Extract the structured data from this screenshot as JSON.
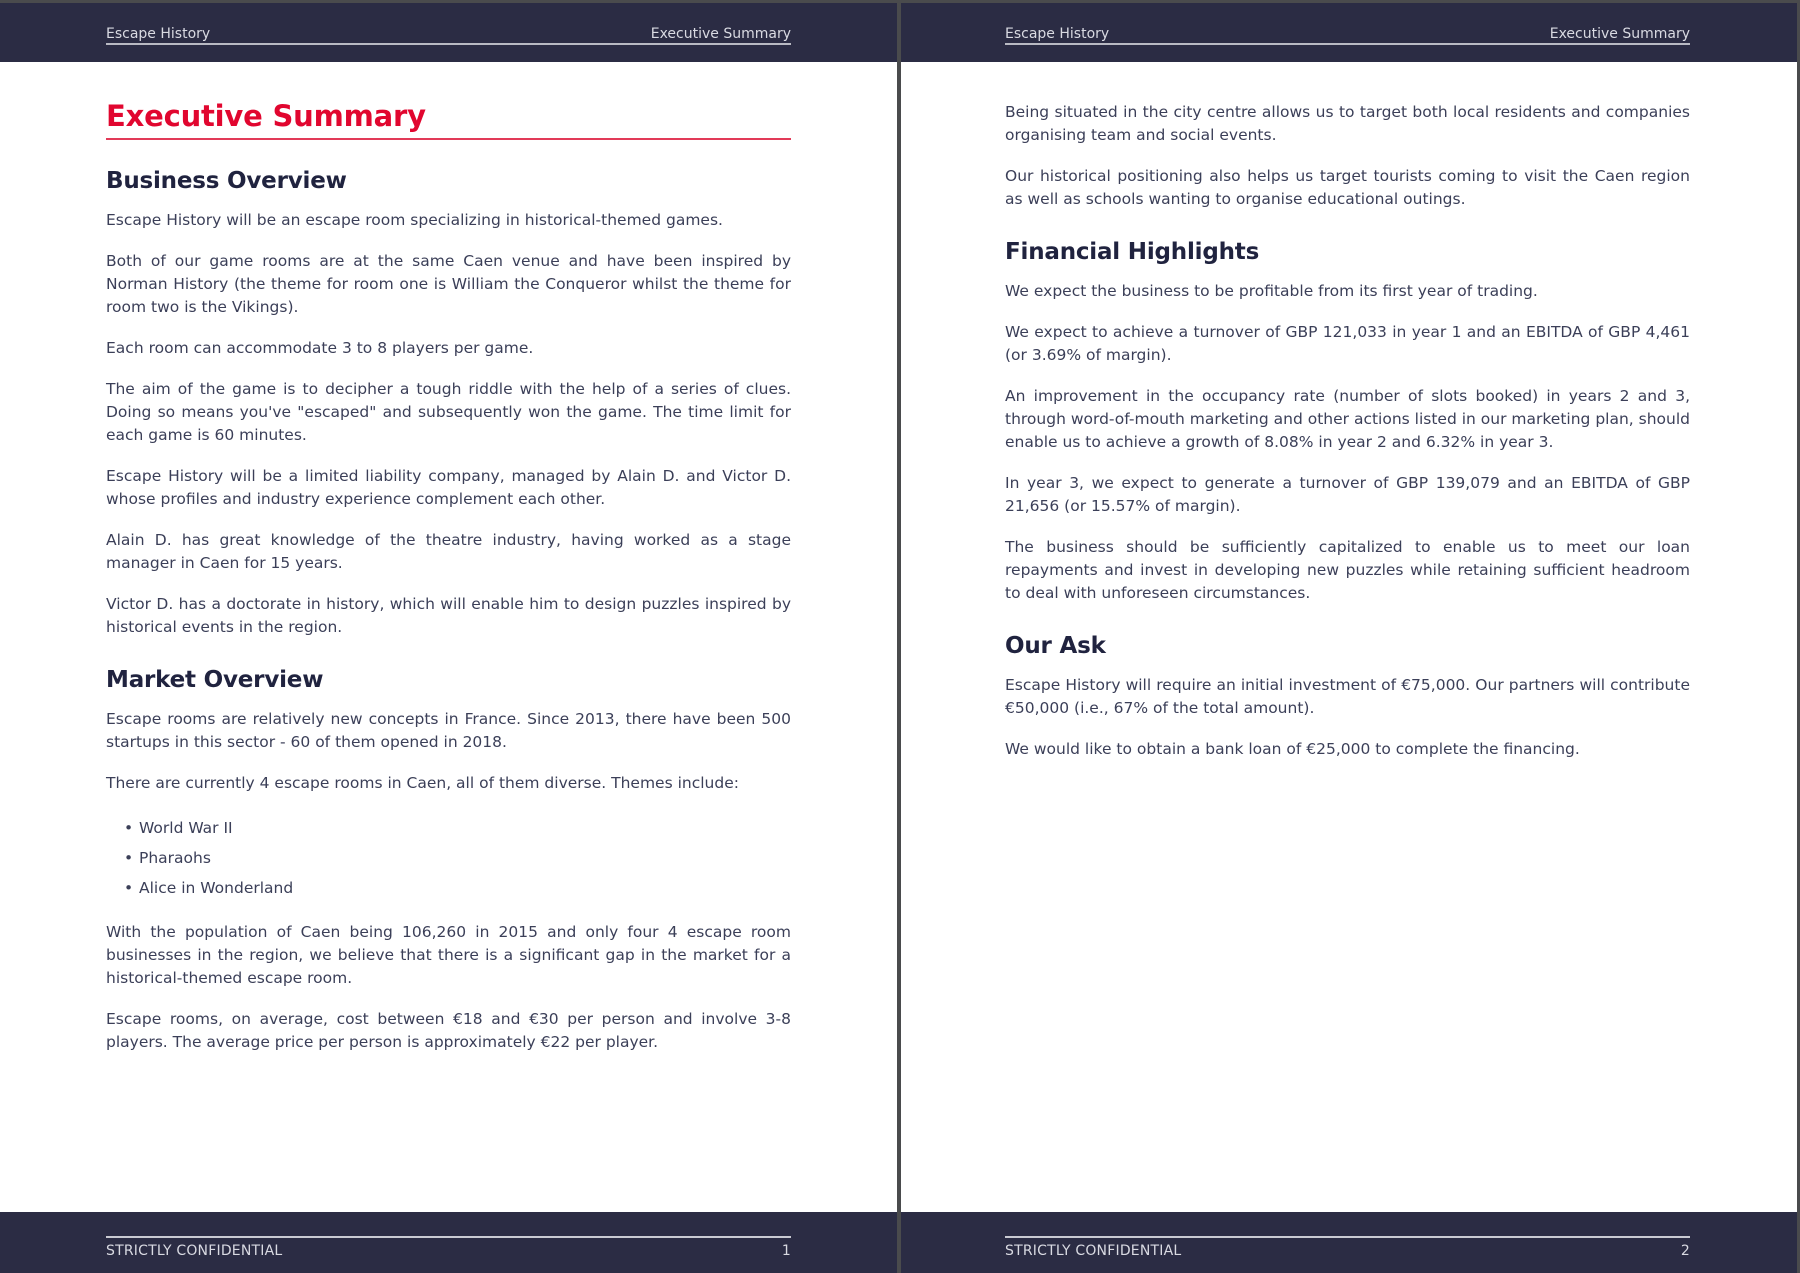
{
  "document": {
    "header_left": "Escape History",
    "header_right": "Executive Summary",
    "footer_label": "STRICTLY CONFIDENTIAL"
  },
  "pages": [
    {
      "page_number": "1",
      "title": "Executive Summary",
      "sections": {
        "business_overview": {
          "heading": "Business Overview",
          "paragraphs": [
            "Escape History will be an escape room specializing in historical-themed games.",
            "Both of our game rooms are at the same Caen venue and have been inspired by Norman History (the theme for room one is William the Conqueror whilst the theme for room two is the Vikings).",
            "Each room can accommodate 3 to 8 players per game.",
            "The aim of the game is to decipher a tough riddle with the help of a series of clues. Doing so means you've \"escaped\" and subsequently won the game. The time limit for each game is 60 minutes.",
            "Escape History will be a limited liability company, managed by Alain D. and Victor D. whose profiles and industry experience complement each other.",
            "Alain D. has great knowledge of the theatre industry, having worked as a stage manager in Caen for 15 years.",
            "Victor D. has a doctorate in history, which will enable him to design puzzles inspired by historical events in the region."
          ]
        },
        "market_overview": {
          "heading": "Market Overview",
          "paragraphs_before_list": [
            "Escape rooms are relatively new concepts in France. Since 2013, there have been 500 startups in this sector - 60 of them opened in 2018.",
            "There are currently 4 escape rooms in Caen, all of them diverse. Themes include:"
          ],
          "themes": [
            "World War II",
            "Pharaohs",
            "Alice in Wonderland"
          ],
          "paragraphs_after_list": [
            "With the population of Caen being 106,260 in 2015 and only four 4 escape room businesses in the region, we believe that there is a significant gap in the market for a historical-themed escape room.",
            "Escape rooms, on average, cost between €18 and €30 per person and involve 3-8 players. The average price per person is approximately €22 per player."
          ]
        }
      }
    },
    {
      "page_number": "2",
      "intro_paragraphs": [
        "Being situated in the city centre allows us to target both local residents and companies organising team and social events.",
        "Our historical positioning also helps us target tourists coming to visit the Caen region as well as schools wanting to organise educational outings."
      ],
      "sections": {
        "financial_highlights": {
          "heading": "Financial Highlights",
          "paragraphs": [
            "We expect the business to be profitable from its first year of trading.",
            "We expect to achieve a turnover of GBP 121,033 in year 1 and an EBITDA of GBP 4,461 (or 3.69% of margin).",
            "An improvement in the occupancy rate (number of slots booked) in years 2 and 3, through word-of-mouth marketing and other actions listed in our marketing plan, should enable us to achieve a growth of 8.08% in year 2 and 6.32% in year 3.",
            "In year 3, we expect to generate a turnover of GBP 139,079 and an EBITDA of GBP 21,656 (or 15.57% of margin).",
            "The business should be sufficiently capitalized to enable us to meet our loan repayments and invest in developing new puzzles while retaining sufficient headroom to deal with unforeseen circumstances."
          ]
        },
        "our_ask": {
          "heading": "Our Ask",
          "paragraphs": [
            "Escape History will require an initial investment of €75,000. Our partners will contribute €50,000 (i.e., 67% of the total amount).",
            "We would like to obtain a bank loan of €25,000 to complete the financing."
          ]
        }
      }
    }
  ],
  "colors": {
    "header_footer_bg": "#2b2c44",
    "title_red": "#e1062f",
    "heading": "#20233f",
    "body_text": "#3b3f58"
  }
}
